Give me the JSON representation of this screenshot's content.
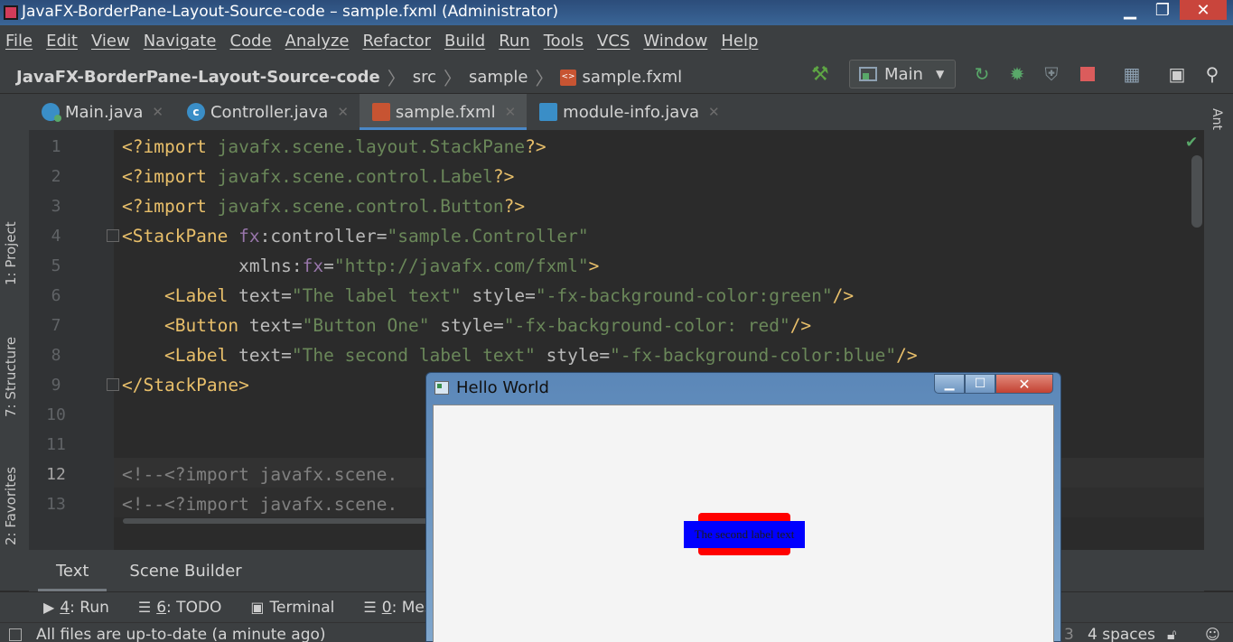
{
  "window": {
    "title": "JavaFX-BorderPane-Layout-Source-code – sample.fxml (Administrator)",
    "min_glyph": "▁",
    "max_glyph": "❐",
    "close_glyph": "✕"
  },
  "menu": [
    "File",
    "Edit",
    "View",
    "Navigate",
    "Code",
    "Analyze",
    "Refactor",
    "Build",
    "Run",
    "Tools",
    "VCS",
    "Window",
    "Help"
  ],
  "breadcrumb": {
    "project": "JavaFX-BorderPane-Layout-Source-code",
    "folder1": "src",
    "folder2": "sample",
    "file": "sample.fxml"
  },
  "toolbar": {
    "run_config": "Main",
    "icons": [
      "hammer-icon",
      "rerun-icon",
      "debug-icon",
      "coverage-icon",
      "stop-icon",
      "project-structure-icon",
      "terminal-icon",
      "search-icon"
    ]
  },
  "side_tabs": {
    "project": "1: Project",
    "structure": "7: Structure",
    "favorites": "2: Favorites",
    "ant": "Ant"
  },
  "tabs": [
    {
      "label": "Main.java"
    },
    {
      "label": "Controller.java"
    },
    {
      "label": "sample.fxml"
    },
    {
      "label": "module-info.java"
    }
  ],
  "editor": {
    "line_numbers": [
      "1",
      "2",
      "3",
      "4",
      "5",
      "6",
      "7",
      "8",
      "9",
      "10",
      "11",
      "12",
      "13"
    ],
    "lines": {
      "l1": {
        "kw": "<?import ",
        "pkg": "javafx.scene.layout.StackPane",
        "end": "?>"
      },
      "l2": {
        "kw": "<?import ",
        "pkg": "javafx.scene.control.Label",
        "end": "?>"
      },
      "l3": {
        "kw": "<?import ",
        "pkg": "javafx.scene.control.Button",
        "end": "?>"
      },
      "l4": {
        "tag": "<StackPane ",
        "ns": "fx",
        "attr": ":controller",
        "eq": "=",
        "val": "\"sample.Controller\""
      },
      "l5": {
        "indent": "           ",
        "attr": "xmlns:",
        "ns": "fx",
        "eq": "=",
        "val": "\"http://javafx.com/fxml\"",
        "end": ">"
      },
      "l6": {
        "indent": "    ",
        "tag": "<Label ",
        "a1": "text",
        "eq": "=",
        "v1": "\"The label text\"",
        "a2": " style",
        "v2": "\"-fx-background-color:green\"",
        "end": "/>"
      },
      "l7": {
        "indent": "    ",
        "tag": "<Button ",
        "a1": "text",
        "eq": "=",
        "v1": "\"Button One\"",
        "a2": " style",
        "v2": "\"-fx-background-color: red\"",
        "end": "/>"
      },
      "l8": {
        "indent": "    ",
        "tag": "<Label ",
        "a1": "text",
        "eq": "=",
        "v1": "\"The second label text\"",
        "a2": " style",
        "v2": "\"-fx-background-color:blue\"",
        "end": "/>"
      },
      "l9": {
        "tag": "</StackPane>"
      },
      "l12": {
        "text": "<!--<?import javafx.scene."
      },
      "l13": {
        "text": "<!--<?import javafx.scene."
      }
    }
  },
  "mode_tabs": [
    "Text",
    "Scene Builder"
  ],
  "tool_windows": [
    {
      "num": "4",
      "label": ": Run"
    },
    {
      "num": "6",
      "label": ": TODO"
    },
    {
      "num": "",
      "label": "Terminal"
    },
    {
      "num": "0",
      "label": ": Mess"
    }
  ],
  "status": {
    "message": "All files are up-to-date (a minute ago)",
    "num": "3",
    "indent": "4 spaces"
  },
  "hello_window": {
    "title": "Hello World",
    "label_text": "The second label text",
    "min_glyph": "▁",
    "max_glyph": "☐",
    "close_glyph": "✕"
  },
  "colors": {
    "button_bg": "#ff0000",
    "label_bg": "#0000ff",
    "first_label_bg": "#008000"
  }
}
